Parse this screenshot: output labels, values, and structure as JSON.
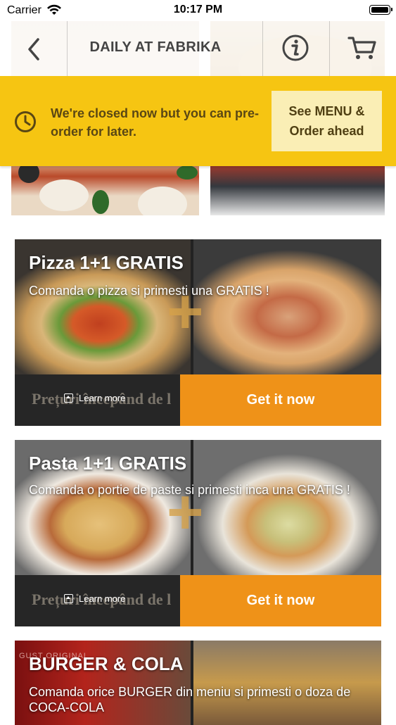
{
  "status_bar": {
    "carrier": "Carrier",
    "time": "10:17 PM"
  },
  "nav": {
    "title": "DAILY AT FABRIKA",
    "icons": [
      "chevron-left-icon",
      "info-icon",
      "cart-icon"
    ]
  },
  "banner": {
    "message": "We're closed now but you can pre-order for later.",
    "cta": "See MENU & Order ahead",
    "color": "#f6c512"
  },
  "promos": [
    {
      "title": "Pizza 1+1 GRATIS",
      "description": "Comanda o pizza si primesti una GRATIS !",
      "learn_more": "Learn more",
      "ghost_text": "Prețuri începând de l",
      "cta": "Get it now"
    },
    {
      "title": "Pasta 1+1 GRATIS",
      "description": "Comanda o portie de paste si primesti inca una GRATIS !",
      "learn_more": "Learn more",
      "ghost_text": "Prețuri începând de l",
      "cta": "Get it now"
    },
    {
      "title": "BURGER & COLA",
      "description": "Comanda orice BURGER din meniu si primesti o doza de COCA-COLA",
      "ghost_text": "GUST ORIGINAL"
    }
  ],
  "colors": {
    "accent": "#ef9218",
    "banner": "#f6c512"
  }
}
